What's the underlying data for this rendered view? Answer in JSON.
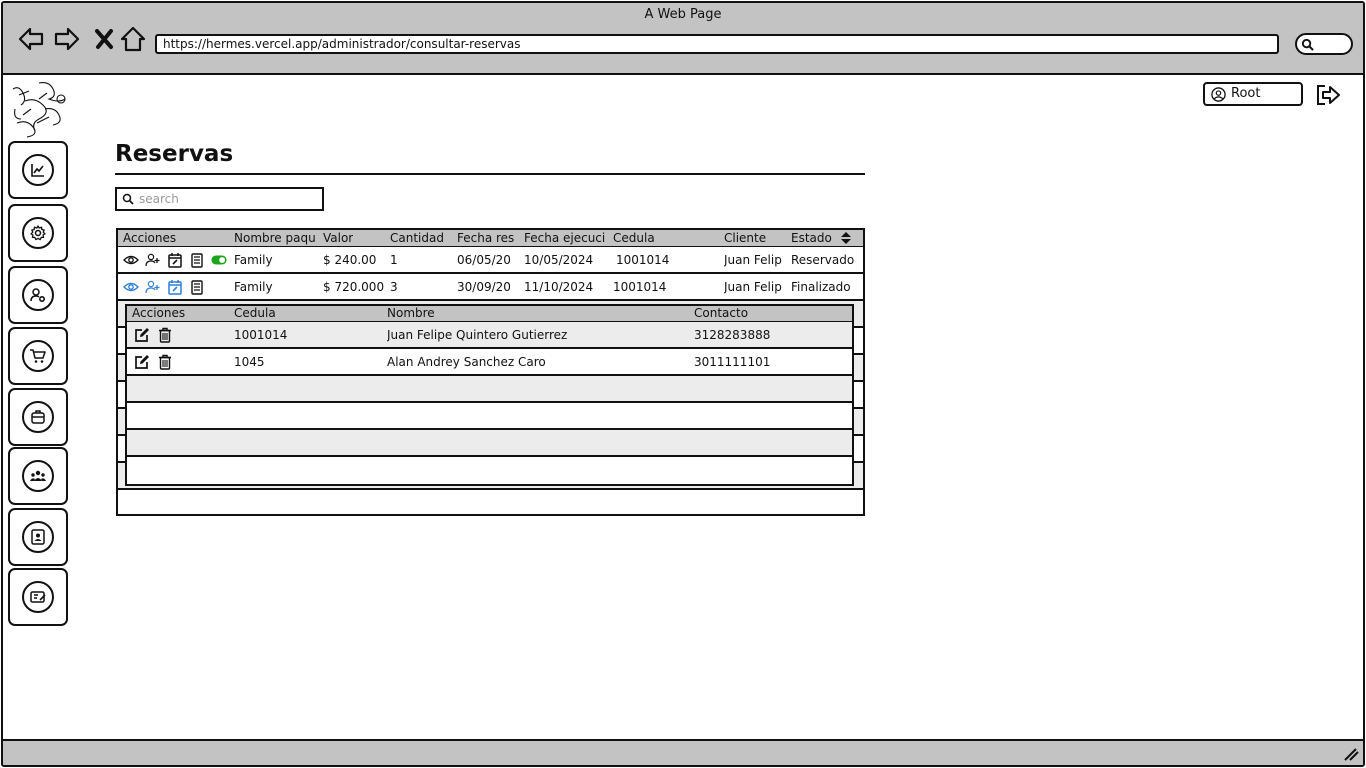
{
  "browser": {
    "window_title": "A Web Page",
    "url": "https://hermes.vercel.app/administrador/consultar-reservas"
  },
  "header": {
    "user_label": "Root"
  },
  "page": {
    "title": "Reservas",
    "search_placeholder": "search"
  },
  "reservas_table": {
    "columns": [
      "Acciones",
      "Nombre paqu",
      "Valor",
      "Cantidad",
      "Fecha res",
      "Fecha ejecuci",
      "Cedula",
      "Cliente",
      "Estado"
    ],
    "rows": [
      {
        "paquete": "Family",
        "valor": "$ 240.00",
        "cantidad": "1",
        "fecha_res": "06/05/20",
        "fecha_ejec": "10/05/2024",
        "cedula": "1001014",
        "cliente": "Juan Felip",
        "estado": "Reservado",
        "toggle_on": true
      },
      {
        "paquete": "Family",
        "valor": "$ 720.000",
        "cantidad": "3",
        "fecha_res": "30/09/20",
        "fecha_ejec": "11/10/2024",
        "cedula": "1001014",
        "cliente": "Juan Felip",
        "estado": "Finalizado",
        "toggle_on": false
      }
    ]
  },
  "beneficiarios_table": {
    "columns": [
      "Acciones",
      "Cedula",
      "Nombre",
      "Contacto"
    ],
    "rows": [
      {
        "cedula": "1001014",
        "nombre": "Juan Felipe Quintero Gutierrez",
        "contacto": "3128283888"
      },
      {
        "cedula": "1045",
        "nombre": "Alan Andrey Sanchez Caro",
        "contacto": "3011111101"
      }
    ]
  },
  "sidebar": {
    "items": [
      {
        "icon": "chart-line-icon"
      },
      {
        "icon": "gear-icon"
      },
      {
        "icon": "user-gear-icon"
      },
      {
        "icon": "cart-icon"
      },
      {
        "icon": "package-icon"
      },
      {
        "icon": "users-group-icon"
      },
      {
        "icon": "contact-card-icon"
      },
      {
        "icon": "ticket-icon"
      }
    ]
  },
  "colors": {
    "chrome_gray": "#c3c3c3",
    "row_alt": "#ececec",
    "accent_blue": "#2f7fd8",
    "toggle_green": "#1aa51a"
  }
}
